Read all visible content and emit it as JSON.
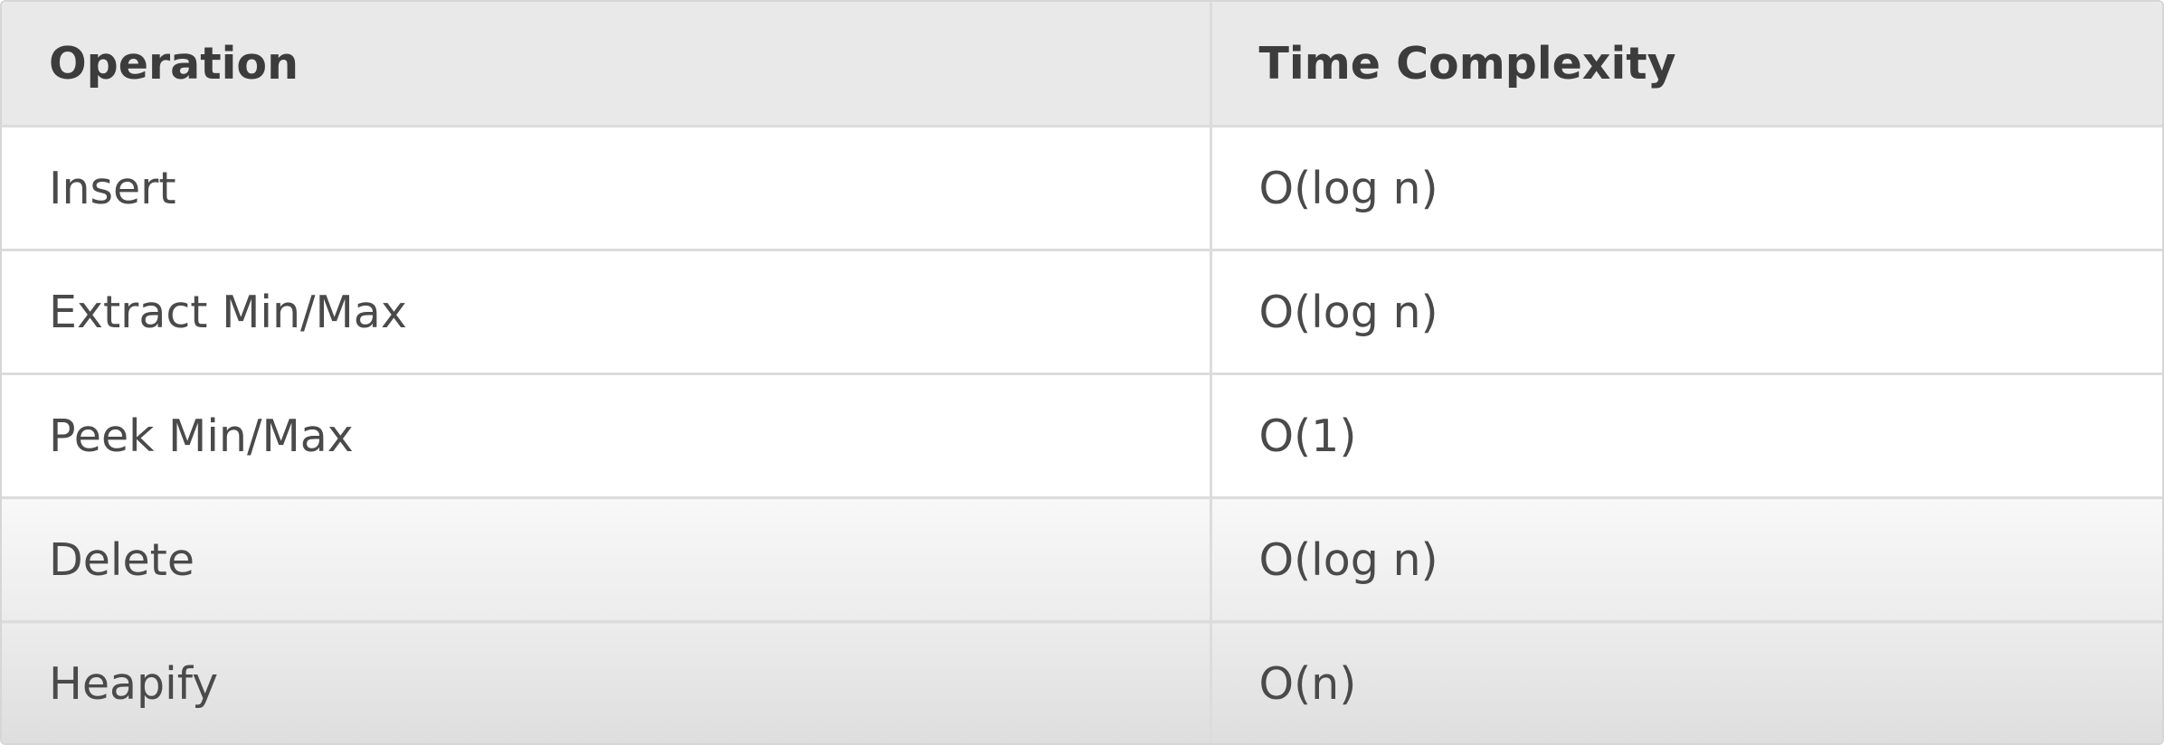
{
  "table": {
    "headers": [
      "Operation",
      "Time Complexity"
    ],
    "rows": [
      [
        "Insert",
        "O(log n)"
      ],
      [
        "Extract Min/Max",
        "O(log n)"
      ],
      [
        "Peek Min/Max",
        "O(1)"
      ],
      [
        "Delete",
        "O(log n)"
      ],
      [
        "Heapify",
        "O(n)"
      ]
    ]
  }
}
